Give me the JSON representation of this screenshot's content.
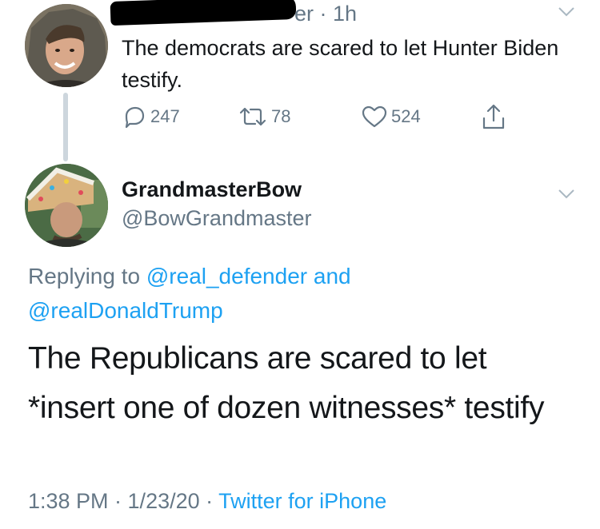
{
  "parent": {
    "time_meta": "er · 1h",
    "text": "The democrats are scared to let Hunter Biden testify.",
    "actions": {
      "replies": "247",
      "retweets": "78",
      "likes": "524"
    }
  },
  "reply": {
    "name": "GrandmasterBow",
    "handle": "@BowGrandmaster",
    "replying_prefix": "Replying to ",
    "mention_1": "@real_defender",
    "and_word": " and ",
    "mention_2": "@realDonaldTrump",
    "text_line_1": "The Republicans are scared to let",
    "text_line_2": "*insert one of dozen witnesses* testify",
    "timestamp": "1:38 PM · 1/23/20 · ",
    "source": "Twitter for iPhone"
  },
  "colors": {
    "link": "#1da1f2",
    "secondary": "#657786",
    "primary_text": "#14171a",
    "thread_line": "#cdd6dd"
  },
  "icons": [
    "reply-icon",
    "retweet-icon",
    "like-icon",
    "share-icon",
    "chevron-down-icon"
  ]
}
